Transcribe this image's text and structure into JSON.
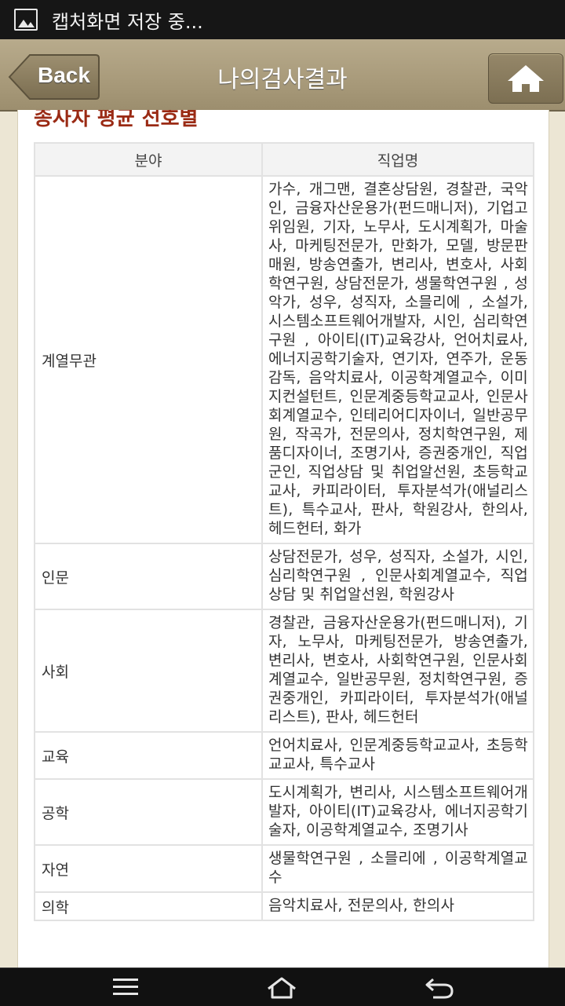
{
  "status_bar": {
    "notification_icon": "image-icon",
    "text": "캡처화면 저장 중..."
  },
  "header": {
    "back_label": "Back",
    "title": "나의검사결과",
    "home_icon": "home-icon"
  },
  "section_title": "종사자 평균 선호별",
  "table": {
    "headers": [
      "분야",
      "직업명"
    ],
    "rows": [
      {
        "field": "계열무관",
        "jobs": "가수, 개그맨, 결혼상담원, 경찰관, 국악인, 금융자산운용가(펀드매니저), 기업고위임원, 기자, 노무사, 도시계획가, 마술사, 마케팅전문가, 만화가, 모델, 방문판매원, 방송연출가, 변리사, 변호사, 사회학연구원, 상담전문가, 생물학연구원 , 성악가, 성우, 성직자, 소믈리에 , 소설가, 시스템소프트웨어개발자, 시인, 심리학연구원 , 아이티(IT)교육강사, 언어치료사, 에너지공학기술자, 연기자, 연주가, 운동감독, 음악치료사, 이공학계열교수, 이미지컨설턴트, 인문계중등학교교사, 인문사회계열교수, 인테리어디자이너, 일반공무원, 작곡가, 전문의사, 정치학연구원, 제품디자이너, 조명기사, 증권중개인, 직업군인, 직업상담 및 취업알선원, 초등학교교사, 카피라이터, 투자분석가(애널리스트), 특수교사, 판사, 학원강사, 한의사, 헤드헌터, 화가"
      },
      {
        "field": "인문",
        "jobs": "상담전문가, 성우, 성직자, 소설가, 시인, 심리학연구원 , 인문사회계열교수, 직업상담 및 취업알선원, 학원강사"
      },
      {
        "field": "사회",
        "jobs": "경찰관, 금융자산운용가(펀드매니저), 기자, 노무사, 마케팅전문가, 방송연출가, 변리사, 변호사, 사회학연구원, 인문사회계열교수, 일반공무원, 정치학연구원, 증권중개인, 카피라이터, 투자분석가(애널리스트), 판사, 헤드헌터"
      },
      {
        "field": "교육",
        "jobs": "언어치료사, 인문계중등학교교사, 초등학교교사, 특수교사"
      },
      {
        "field": "공학",
        "jobs": "도시계획가, 변리사, 시스템소프트웨어개발자, 아이티(IT)교육강사, 에너지공학기술자, 이공학계열교수, 조명기사"
      },
      {
        "field": "자연",
        "jobs": "생물학연구원 , 소믈리에 , 이공학계열교수"
      },
      {
        "field": "의학",
        "jobs": "음악치료사, 전문의사, 한의사"
      }
    ]
  },
  "nav_bar": {
    "menu_icon": "menu-icon",
    "home_icon": "home-outline-icon",
    "back_icon": "back-arrow-icon"
  },
  "colors": {
    "header_bg": "#a89a7a",
    "section_title": "#9a2a14",
    "page_bg": "#ece6d4"
  }
}
